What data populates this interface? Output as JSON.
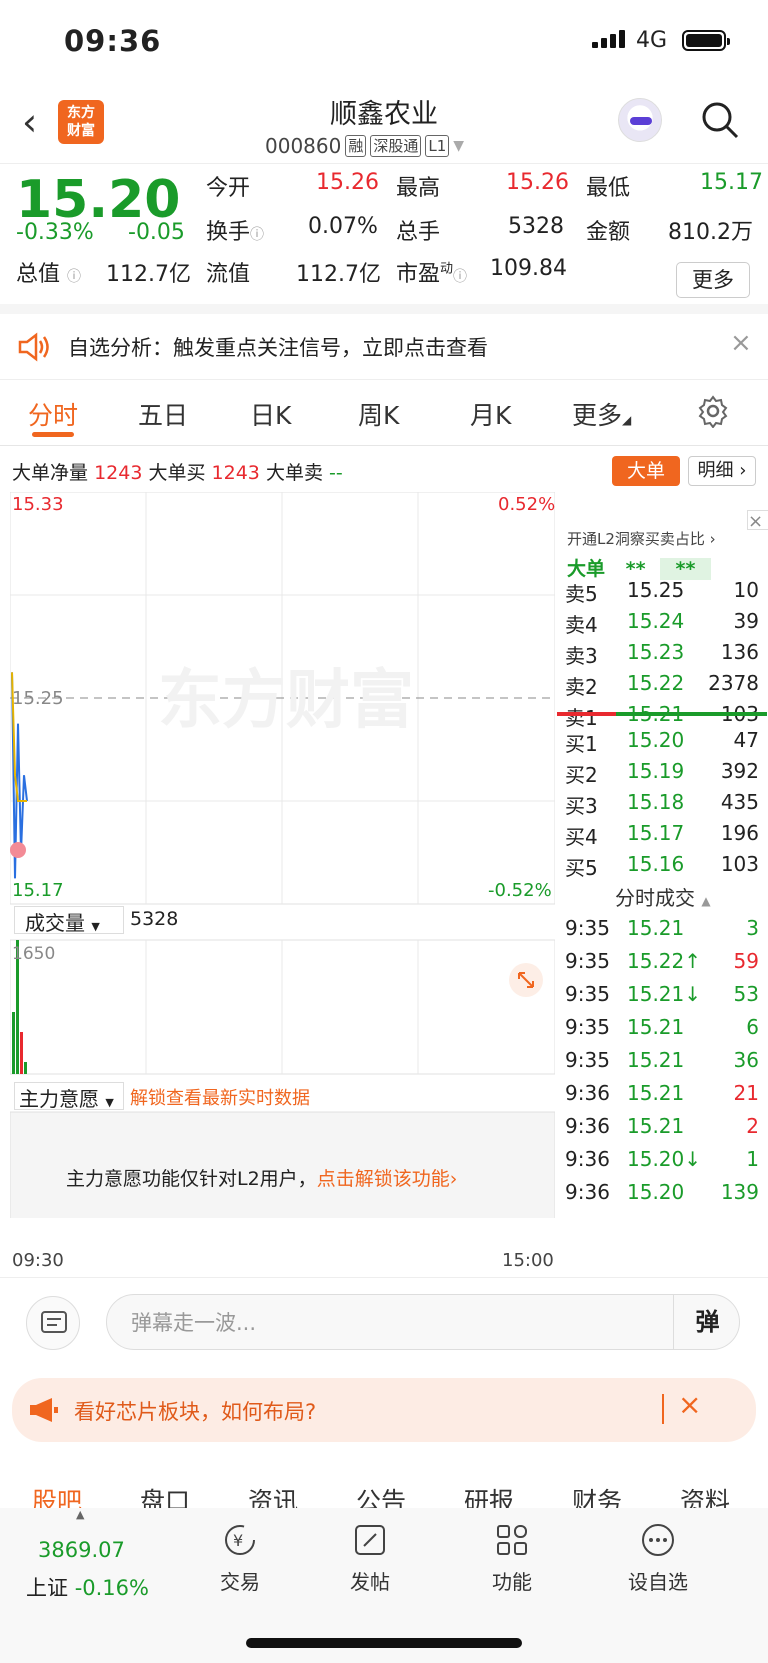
{
  "status": {
    "time": "09:36",
    "network": "4G"
  },
  "header": {
    "logo_line1": "东方",
    "logo_line2": "财富",
    "name": "顺鑫农业",
    "code": "000860",
    "tags": [
      "融",
      "深股通",
      "L1"
    ]
  },
  "quote": {
    "price": "15.20",
    "pct": "-0.33%",
    "chg": "-0.05",
    "open_l": "今开",
    "open": "15.26",
    "high_l": "最高",
    "high": "15.26",
    "low_l": "最低",
    "low": "15.17",
    "turn_l": "换手",
    "turn": "0.07%",
    "vol_l": "总手",
    "vol": "5328",
    "amt_l": "金额",
    "amt": "810.2万",
    "mcap_l": "总值",
    "mcap": "112.7亿",
    "fcap_l": "流值",
    "fcap": "112.7亿",
    "pe_l": "市盈",
    "pe_sup": "动",
    "pe": "109.84",
    "more": "更多"
  },
  "notice": {
    "text": "自选分析：触发重点关注信号，立即点击查看"
  },
  "tabs": [
    "分时",
    "五日",
    "日K",
    "周K",
    "月K",
    "更多"
  ],
  "bignet": {
    "l1": "大单净量",
    "v1": "1243",
    "l2": "大单买",
    "v2": "1243",
    "l3": "大单卖",
    "v3": "--",
    "btn1": "大单",
    "btn2": "明细"
  },
  "chart": {
    "top_price": "15.33",
    "top_pct": "0.52%",
    "mid_price": "15.25",
    "bot_price": "15.17",
    "bot_pct": "-0.52%",
    "watermark": "东方财富",
    "vol_label": "成交量",
    "vol_val": "5328",
    "vol_max": "1650",
    "zl_label": "主力意愿",
    "zl_link": "解锁查看最新实时数据",
    "zl_msg": "主力意愿功能仅针对L2用户，",
    "zl_unlock": "点击解锁该功能",
    "t_start": "09:30",
    "t_end": "15:00"
  },
  "chart_data": {
    "type": "line",
    "x": [
      "09:30",
      "09:31",
      "09:32",
      "09:33",
      "09:34",
      "09:35"
    ],
    "series": [
      {
        "values": [
          15.26,
          15.18,
          15.24,
          15.19,
          15.22,
          15.21
        ]
      },
      {
        "values": [
          15.26,
          15.22,
          15.21,
          15.21,
          15.21,
          15.21
        ]
      }
    ],
    "ylim": [
      15.17,
      15.33
    ],
    "yticks": [
      "15.33",
      "15.25",
      "15.17"
    ]
  },
  "book": {
    "promo": "开通L2洞察买卖占比",
    "big_l": "大单",
    "big_v1": "**",
    "big_v2": "**",
    "asks": [
      {
        "l": "卖5",
        "p": "15.25",
        "v": "10"
      },
      {
        "l": "卖4",
        "p": "15.24",
        "v": "39"
      },
      {
        "l": "卖3",
        "p": "15.23",
        "v": "136"
      },
      {
        "l": "卖2",
        "p": "15.22",
        "v": "2378"
      },
      {
        "l": "卖1",
        "p": "15.21",
        "v": "103"
      }
    ],
    "bids": [
      {
        "l": "买1",
        "p": "15.20",
        "v": "47"
      },
      {
        "l": "买2",
        "p": "15.19",
        "v": "392"
      },
      {
        "l": "买3",
        "p": "15.18",
        "v": "435"
      },
      {
        "l": "买4",
        "p": "15.17",
        "v": "196"
      },
      {
        "l": "买5",
        "p": "15.16",
        "v": "103"
      }
    ],
    "ticks_title": "分时成交",
    "ticks": [
      {
        "t": "9:35",
        "p": "15.21",
        "v": "3",
        "c": "g"
      },
      {
        "t": "9:35",
        "p": "15.22↑",
        "v": "59",
        "c": "r"
      },
      {
        "t": "9:35",
        "p": "15.21↓",
        "v": "53",
        "c": "g"
      },
      {
        "t": "9:35",
        "p": "15.21",
        "v": "6",
        "c": "g"
      },
      {
        "t": "9:35",
        "p": "15.21",
        "v": "36",
        "c": "g"
      },
      {
        "t": "9:36",
        "p": "15.21",
        "v": "21",
        "c": "r"
      },
      {
        "t": "9:36",
        "p": "15.21",
        "v": "2",
        "c": "r"
      },
      {
        "t": "9:36",
        "p": "15.20↓",
        "v": "1",
        "c": "g"
      },
      {
        "t": "9:36",
        "p": "15.20",
        "v": "139",
        "c": "g"
      }
    ]
  },
  "comment": {
    "placeholder": "弹幕走一波...",
    "btn": "弹"
  },
  "banner": {
    "text": "看好芯片板块，如何布局?"
  },
  "nav": [
    "股吧",
    "盘口",
    "资讯",
    "公告",
    "研报",
    "财务",
    "资料"
  ],
  "footer": {
    "index_val": "3869.07",
    "index_name": "上证",
    "index_pct": "-0.16%",
    "items": [
      "交易",
      "发帖",
      "功能",
      "设自选"
    ]
  }
}
